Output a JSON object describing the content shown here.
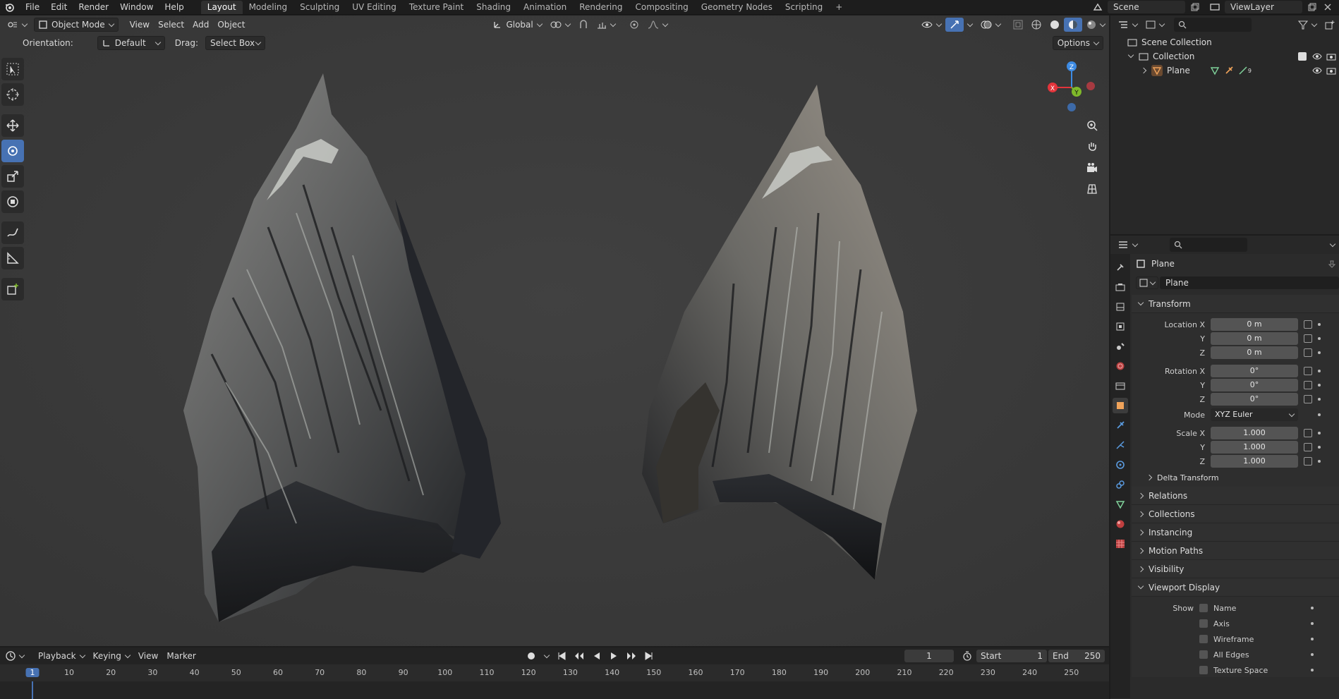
{
  "topbar": {
    "menus": [
      "File",
      "Edit",
      "Render",
      "Window",
      "Help"
    ],
    "workspaces": [
      "Layout",
      "Modeling",
      "Sculpting",
      "UV Editing",
      "Texture Paint",
      "Shading",
      "Animation",
      "Rendering",
      "Compositing",
      "Geometry Nodes",
      "Scripting"
    ],
    "active_workspace": "Layout",
    "add_tab": "+",
    "scene_label": "Scene",
    "viewlayer_label": "ViewLayer"
  },
  "viewport": {
    "mode": "Object Mode",
    "menus": [
      "View",
      "Select",
      "Add",
      "Object"
    ],
    "transform_orientation": "Global",
    "orientation_label": "Orientation:",
    "orientation_value": "Default",
    "drag_label": "Drag:",
    "drag_value": "Select Box",
    "options_label": "Options",
    "gizmo_axes": {
      "z": "Z",
      "x": "X",
      "y": "Y"
    }
  },
  "outliner": {
    "rows": [
      {
        "label": "Scene Collection",
        "depth": 0
      },
      {
        "label": "Collection",
        "depth": 1
      },
      {
        "label": "Plane",
        "depth": 2
      }
    ],
    "modifier_count": "9"
  },
  "properties": {
    "object_name": "Plane",
    "data_name": "Plane",
    "transform_header": "Transform",
    "location": {
      "label": "Location X",
      "x": "0 m",
      "y": "0 m",
      "z": "0 m"
    },
    "rotation": {
      "label": "Rotation X",
      "x": "0°",
      "y": "0°",
      "z": "0°"
    },
    "mode": {
      "label": "Mode",
      "value": "XYZ Euler"
    },
    "scale": {
      "label": "Scale X",
      "x": "1.000",
      "y": "1.000",
      "z": "1.000"
    },
    "axis_y": "Y",
    "axis_z": "Z",
    "delta_transform": "Delta Transform",
    "sections": [
      "Relations",
      "Collections",
      "Instancing",
      "Motion Paths",
      "Visibility"
    ],
    "viewport_display": "Viewport Display",
    "show_label": "Show",
    "show_options": [
      "Name",
      "Axis",
      "Wireframe",
      "All Edges",
      "Texture Space"
    ]
  },
  "timeline": {
    "menus": [
      "Playback",
      "Keying",
      "View",
      "Marker"
    ],
    "current_frame": "1",
    "start_label": "Start",
    "start_value": "1",
    "end_label": "End",
    "end_value": "250",
    "ruler_ticks": [
      "1",
      "10",
      "20",
      "30",
      "40",
      "50",
      "60",
      "70",
      "80",
      "90",
      "100",
      "110",
      "120",
      "130",
      "140",
      "150",
      "160",
      "170",
      "180",
      "190",
      "200",
      "210",
      "220",
      "230",
      "240",
      "250"
    ]
  },
  "colors": {
    "accent": "#4772b3",
    "x_axis": "#e3343b",
    "y_axis": "#7fb92a",
    "z_axis": "#3d8be3"
  }
}
